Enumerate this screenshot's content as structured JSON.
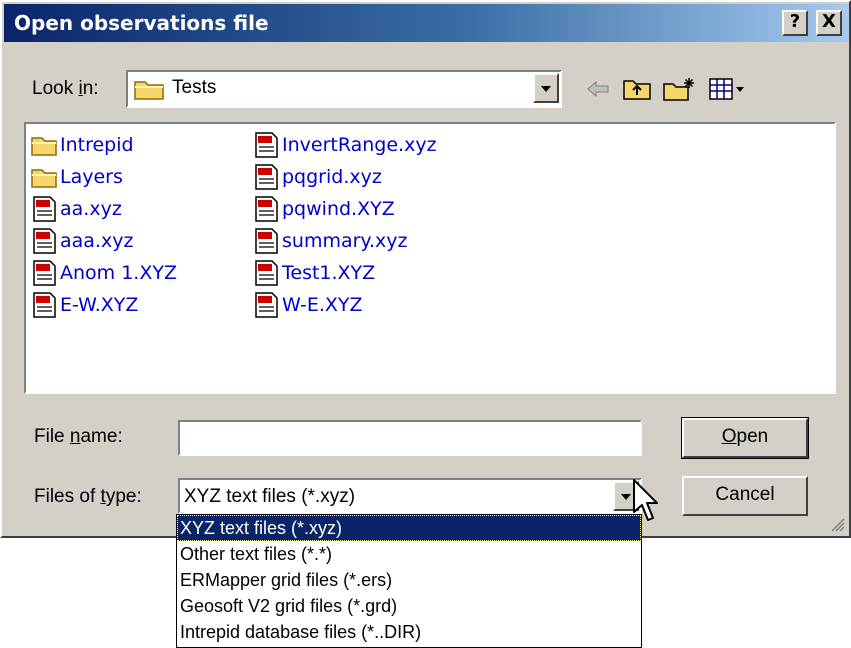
{
  "window": {
    "title": "Open observations file",
    "help_glyph": "?",
    "close_glyph": "X"
  },
  "lookin": {
    "label_pre": "Look ",
    "label_key": "i",
    "label_post": "n:",
    "value": "Tests",
    "icons": [
      "back-arrow-icon",
      "up-folder-icon",
      "new-folder-icon",
      "view-menu-icon"
    ]
  },
  "files": [
    {
      "name": "Intrepid",
      "type": "folder"
    },
    {
      "name": "Layers",
      "type": "folder"
    },
    {
      "name": "aa.xyz",
      "type": "doc"
    },
    {
      "name": "aaa.xyz",
      "type": "doc"
    },
    {
      "name": "Anom 1.XYZ",
      "type": "doc"
    },
    {
      "name": "E-W.XYZ",
      "type": "doc"
    },
    {
      "name": "InvertRange.xyz",
      "type": "doc"
    },
    {
      "name": "pqgrid.xyz",
      "type": "doc"
    },
    {
      "name": "pqwind.XYZ",
      "type": "doc"
    },
    {
      "name": "summary.xyz",
      "type": "doc"
    },
    {
      "name": "Test1.XYZ",
      "type": "doc"
    },
    {
      "name": "W-E.XYZ",
      "type": "doc"
    }
  ],
  "filename": {
    "label_pre": "File ",
    "label_key": "n",
    "label_post": "ame:",
    "value": ""
  },
  "filetype": {
    "label_pre": "Files of ",
    "label_key": "t",
    "label_post": "ype:",
    "value": "XYZ text files (*.xyz)",
    "options": [
      "XYZ text files (*.xyz)",
      "Other text files (*.*)",
      "ERMapper grid files (*.ers)",
      "Geosoft V2 grid files (*.grd)",
      "Intrepid database files (*..DIR)"
    ],
    "selected_index": 0
  },
  "buttons": {
    "open_key": "O",
    "open_rest": "pen",
    "cancel": "Cancel"
  },
  "colors": {
    "title_start": "#0a246a",
    "title_end": "#a6caf0",
    "link": "#0000cc",
    "selection": "#0a246a"
  }
}
